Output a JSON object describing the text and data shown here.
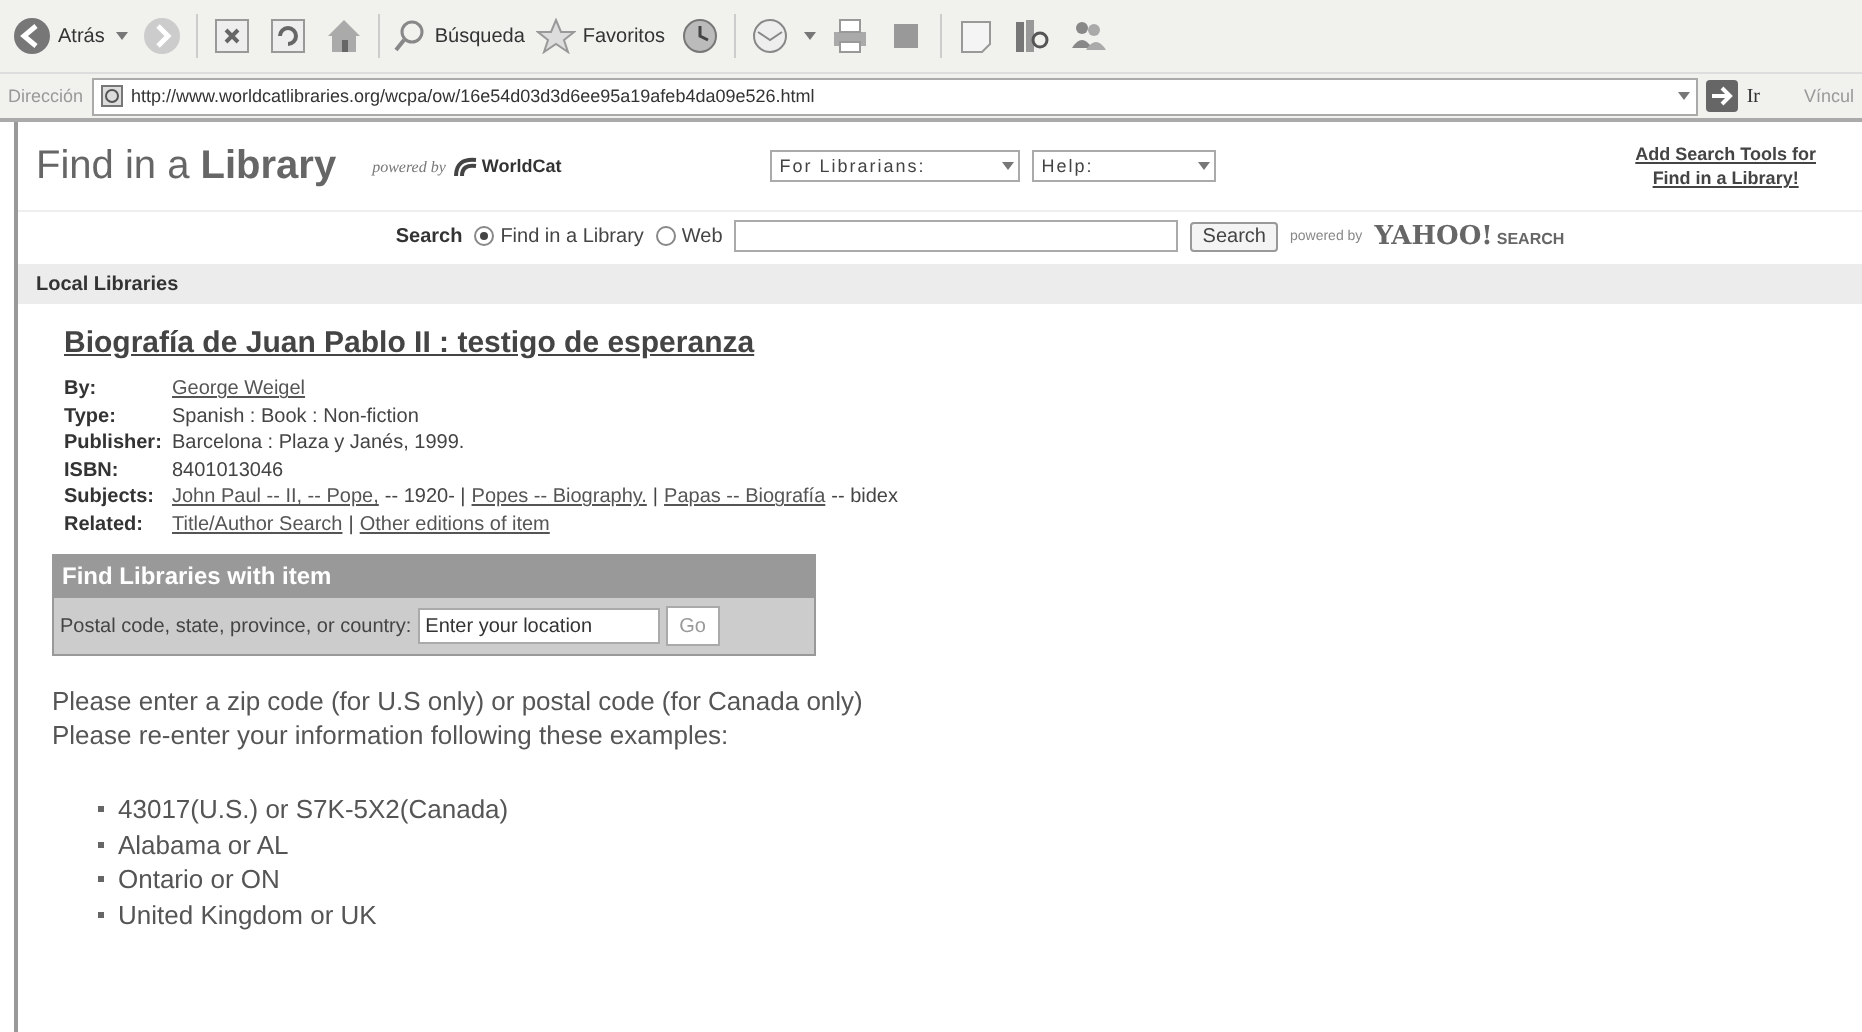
{
  "toolbar": {
    "back_label": "Atrás",
    "search_label": "Búsqueda",
    "favorites_label": "Favoritos"
  },
  "address_bar": {
    "label": "Dirección",
    "url": "http://www.worldcatlibraries.org/wcpa/ow/16e54d03d3d6ee95a19afeb4da09e526.html",
    "go_label": "Ir",
    "links_label": "Víncul"
  },
  "header": {
    "title": "Find in a **Library**",
    "powered_by": "powered by",
    "brand": "WorldCat",
    "selects": [
      "For Librarians:",
      "Help:"
    ],
    "add_tools_link": [
      "Add Search Tools for",
      "Find in a Library!"
    ]
  },
  "search": {
    "label": "Search",
    "options": [
      {
        "label": "Find in a Library",
        "selected": true
      },
      {
        "label": "Web",
        "selected": false
      }
    ],
    "button": "Search",
    "powered_by": "powered by",
    "engine": "YAHOO!",
    "engine_suffix": "SEARCH"
  },
  "section_bar": "Local Libraries",
  "item": {
    "title": "Biografía de Juan Pablo II : testigo de esperanza",
    "details": [
      {
        "label": "By:",
        "parts": [
          {
            "text": "George Weigel",
            "link": true
          }
        ]
      },
      {
        "label": "Type:",
        "parts": [
          {
            "text": "Spanish : Book : Non-fiction",
            "link": false
          }
        ]
      },
      {
        "label": "Publisher:",
        "parts": [
          {
            "text": "Barcelona : Plaza y Janés, 1999.",
            "link": false
          }
        ]
      },
      {
        "label": "ISBN:",
        "parts": [
          {
            "text": "8401013046",
            "link": false
          }
        ]
      },
      {
        "label": "Subjects:",
        "parts": [
          {
            "text": "John Paul -- II, -- Pope,",
            "link": true
          },
          {
            "text": "-- 1920- |",
            "link": false
          },
          {
            "text": "Popes -- Biography.",
            "link": true
          },
          {
            "text": "|",
            "link": false
          },
          {
            "text": "Papas -- Biografía",
            "link": true
          },
          {
            "text": "-- bidex",
            "link": false
          }
        ]
      },
      {
        "label": "Related:",
        "parts": [
          {
            "text": "Title/Author Search",
            "link": true
          },
          {
            "text": "|",
            "link": false
          },
          {
            "text": "Other editions of item",
            "link": true
          }
        ]
      }
    ]
  },
  "find_box": {
    "title": "Find Libraries with item",
    "label": "Postal code, state, province, or country:",
    "placeholder": "Enter your location",
    "button": "Go"
  },
  "messages": [
    "Please enter a zip code (for U.S only) or postal code (for Canada only)",
    "Please re-enter your information following these examples:"
  ],
  "examples": [
    "43017(U.S.) or S7K-5X2(Canada)",
    "Alabama or AL",
    "Ontario or ON",
    "United Kingdom or UK"
  ]
}
